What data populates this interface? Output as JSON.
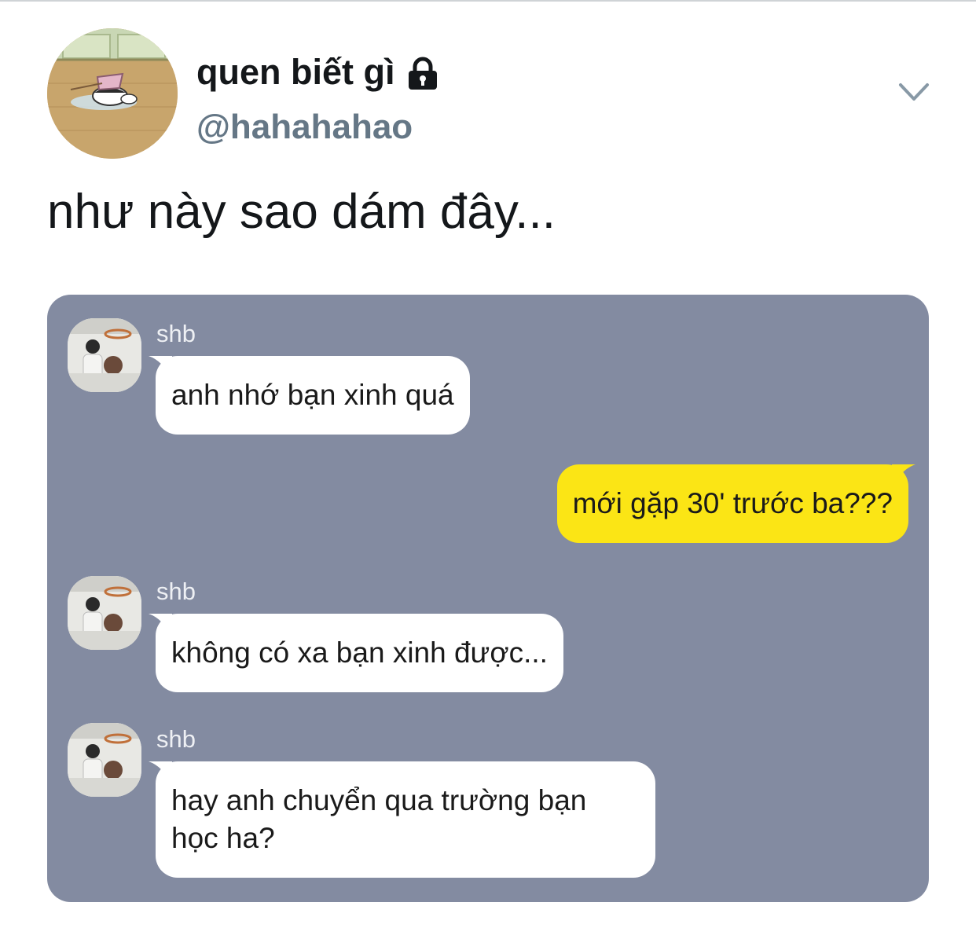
{
  "author": {
    "display_name": "quen biết gì",
    "handle": "@hahahahao",
    "protected_icon": "lock-icon",
    "more_icon": "chevron-down-icon"
  },
  "tweet": {
    "text": "như này sao dám đây..."
  },
  "chat": {
    "background_color": "#838ba1",
    "incoming_bubble_color": "#ffffff",
    "outgoing_bubble_color": "#fbe515",
    "messages": [
      {
        "sender": "shb",
        "text": "anh nhớ bạn xinh quá",
        "direction": "incoming"
      },
      {
        "sender": "",
        "text": "mới gặp 30' trước ba???",
        "direction": "outgoing"
      },
      {
        "sender": "shb",
        "text": "không có xa bạn xinh được...",
        "direction": "incoming"
      },
      {
        "sender": "shb",
        "lines": [
          "hay anh chuyển qua trường bạn",
          "học ha?"
        ],
        "direction": "incoming"
      }
    ]
  }
}
